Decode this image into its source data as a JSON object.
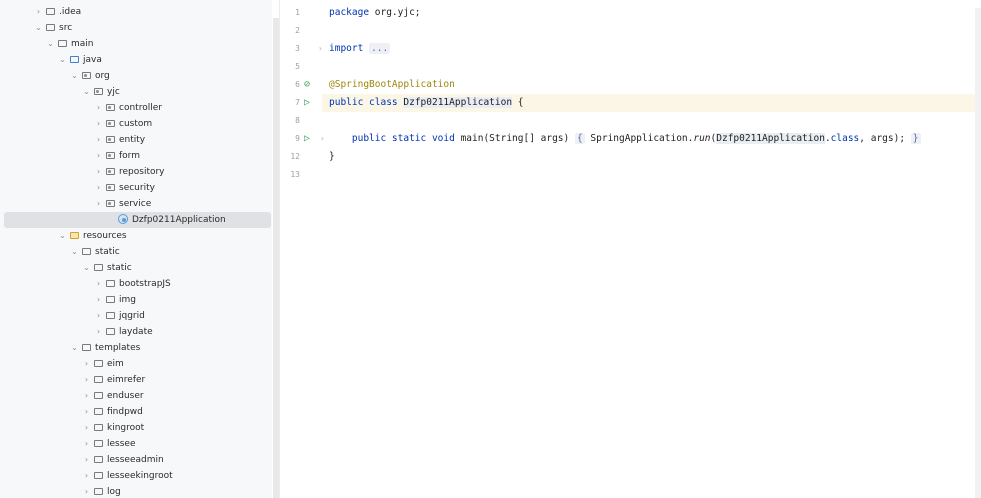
{
  "tree": {
    "rows": [
      {
        "chevron": ">",
        "icon": "folder-icon",
        "label": ".idea"
      },
      {
        "chevron": "v",
        "icon": "folder-icon",
        "label": "src"
      },
      {
        "chevron": "v",
        "icon": "folder-icon",
        "label": "main"
      },
      {
        "chevron": "v",
        "icon": "source-folder-icon",
        "label": "java"
      },
      {
        "chevron": "v",
        "icon": "package-icon",
        "label": "org"
      },
      {
        "chevron": "v",
        "icon": "package-icon",
        "label": "yjc"
      },
      {
        "chevron": ">",
        "icon": "package-icon",
        "label": "controller"
      },
      {
        "chevron": ">",
        "icon": "package-icon",
        "label": "custom"
      },
      {
        "chevron": ">",
        "icon": "package-icon",
        "label": "entity"
      },
      {
        "chevron": ">",
        "icon": "package-icon",
        "label": "form"
      },
      {
        "chevron": ">",
        "icon": "package-icon",
        "label": "repository"
      },
      {
        "chevron": ">",
        "icon": "package-icon",
        "label": "security"
      },
      {
        "chevron": ">",
        "icon": "package-icon",
        "label": "service"
      },
      {
        "chevron": "",
        "icon": "spring-class-icon",
        "label": "Dzfp0211Application"
      },
      {
        "chevron": "v",
        "icon": "resources-folder-icon",
        "label": "resources"
      },
      {
        "chevron": "v",
        "icon": "folder-icon",
        "label": "static"
      },
      {
        "chevron": "v",
        "icon": "folder-icon",
        "label": "static"
      },
      {
        "chevron": ">",
        "icon": "folder-icon",
        "label": "bootstrapJS"
      },
      {
        "chevron": ">",
        "icon": "folder-icon",
        "label": "img"
      },
      {
        "chevron": ">",
        "icon": "folder-icon",
        "label": "jqgrid"
      },
      {
        "chevron": ">",
        "icon": "folder-icon",
        "label": "laydate"
      },
      {
        "chevron": "v",
        "icon": "folder-icon",
        "label": "templates"
      },
      {
        "chevron": ">",
        "icon": "folder-icon",
        "label": "eim"
      },
      {
        "chevron": ">",
        "icon": "folder-icon",
        "label": "eimrefer"
      },
      {
        "chevron": ">",
        "icon": "folder-icon",
        "label": "enduser"
      },
      {
        "chevron": ">",
        "icon": "folder-icon",
        "label": "findpwd"
      },
      {
        "chevron": ">",
        "icon": "folder-icon",
        "label": "kingroot"
      },
      {
        "chevron": ">",
        "icon": "folder-icon",
        "label": "lessee"
      },
      {
        "chevron": ">",
        "icon": "folder-icon",
        "label": "lesseeadmin"
      },
      {
        "chevron": ">",
        "icon": "folder-icon",
        "label": "lesseekingroot"
      },
      {
        "chevron": ">",
        "icon": "folder-icon",
        "label": "log"
      }
    ]
  },
  "editor": {
    "line_numbers": [
      "1",
      "2",
      "3",
      "5",
      "6",
      "7",
      "8",
      "9",
      "12",
      "13"
    ],
    "code": {
      "package_kw": "package",
      "package_name": " org.yjc;",
      "import_kw": "import",
      "import_fold": "...",
      "annotation": "@SpringBootApplication",
      "class_decl_kw": "public class",
      "class_name": "Dzfp0211Application",
      "class_open": " {",
      "main_kw": "public static void",
      "main_sig": " main(String[] args) ",
      "main_body_open": "{",
      "main_body_mid": " SpringApplication.",
      "main_run": "run",
      "main_arg_open": "(",
      "main_class_ref": "Dzfp0211Application",
      "main_dot": ".",
      "main_class_kw": "class",
      "main_args_end": ", args); ",
      "main_body_close": "}",
      "class_close": "}"
    }
  }
}
